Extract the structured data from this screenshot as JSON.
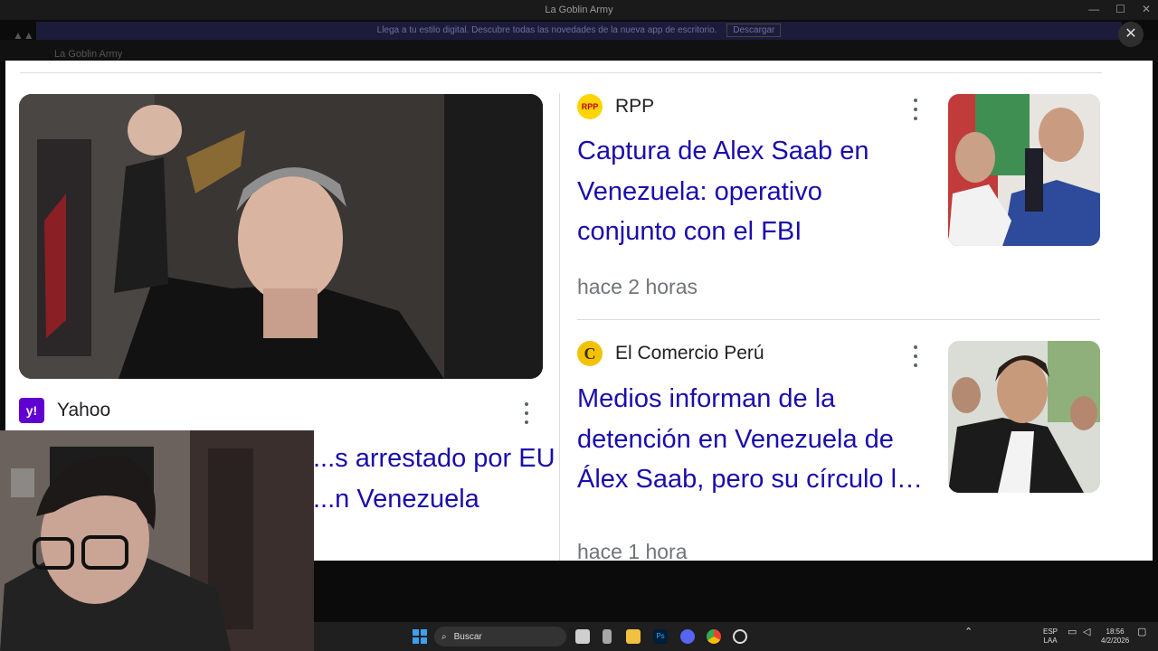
{
  "window": {
    "title": "La Goblin Army"
  },
  "notice": {
    "text": "Llega a tu estilo digital. Descubre todas las novedades de la nueva app de escritorio.",
    "button": "Descargar"
  },
  "appbar": {
    "name": "La Goblin Army"
  },
  "overlay": {
    "close_label": "✕"
  },
  "articles": {
    "hero": {
      "source": "Yahoo",
      "logo_text": "y!",
      "headline_line1": "...s arrestado por EU",
      "headline_line2": "...n Venezuela"
    },
    "rpp": {
      "source": "RPP",
      "logo_text": "RPP",
      "headline": "Captura de Alex Saab en Venezuela: operativo conjunto con el FBI",
      "time": "hace 2 horas"
    },
    "comercio": {
      "source": "El Comercio Perú",
      "logo_text": "C",
      "headline": "Medios informan de la detención en Venezuela de Álex Saab, pero su círculo l…",
      "time": "hace 1 hora"
    }
  },
  "taskbar": {
    "search_placeholder": "Buscar",
    "lang_top": "ESP",
    "lang_bottom": "LAA",
    "time": "18:56",
    "date": "4/2/2026",
    "icons": [
      "windows-start-icon",
      "file-explorer-icon",
      "photoshop-icon",
      "discord-icon",
      "chrome-icon",
      "obs-icon"
    ]
  },
  "colors": {
    "link": "#1a0dab",
    "meta": "#70757a",
    "yahoo": "#6001d2",
    "rpp": "#ffd400",
    "comercio": "#f2c200"
  }
}
